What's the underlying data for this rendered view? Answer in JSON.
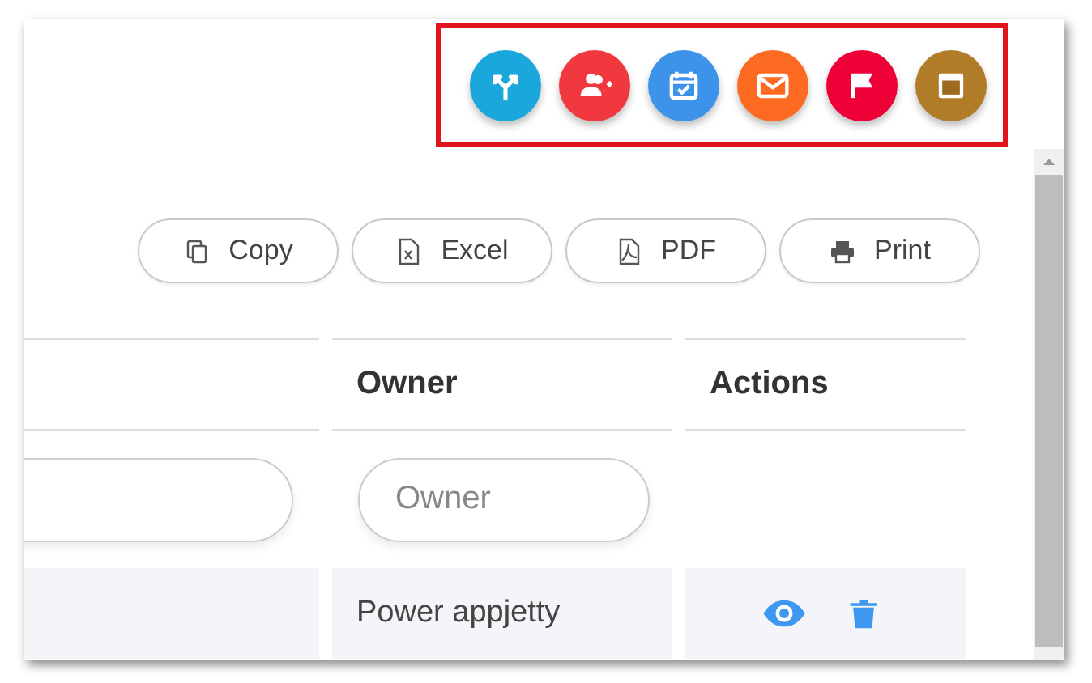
{
  "quick_actions": [
    {
      "kind": "split",
      "color": "#1aa7dc"
    },
    {
      "kind": "add-people",
      "color": "#f2383f"
    },
    {
      "kind": "calendar-check",
      "color": "#3d93ea"
    },
    {
      "kind": "mail",
      "color": "#fc6b21"
    },
    {
      "kind": "flag",
      "color": "#ee0137"
    },
    {
      "kind": "calendar",
      "color": "#b07c27"
    }
  ],
  "export_buttons": [
    {
      "kind": "copy",
      "label": "Copy"
    },
    {
      "kind": "excel",
      "label": "Excel"
    },
    {
      "kind": "pdf",
      "label": "PDF"
    },
    {
      "kind": "print",
      "label": "Print"
    }
  ],
  "table": {
    "columns": [
      {
        "heading": "Owner",
        "filter_placeholder": "Owner"
      },
      {
        "heading": "Actions"
      }
    ],
    "rows": [
      {
        "owner": "Power appjetty"
      }
    ]
  }
}
